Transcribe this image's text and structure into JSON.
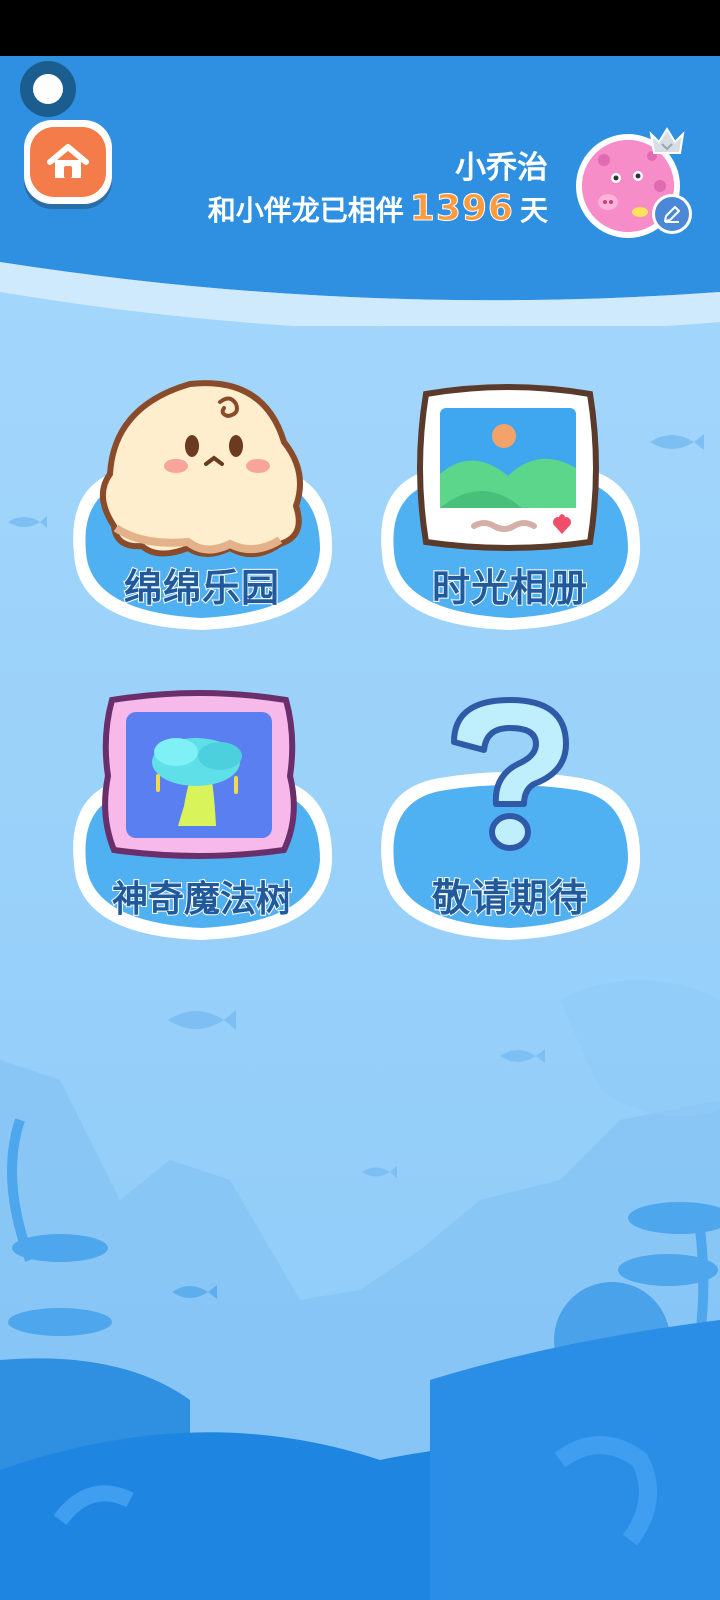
{
  "header": {
    "user_name": "小乔治",
    "companion_prefix": "和小伴龙已相伴",
    "days": "1396",
    "companion_suffix": "天"
  },
  "icons": {
    "home": "home-icon",
    "edit": "pencil-icon",
    "avatar": "pink-pig-avatar",
    "crown": "crown-icon"
  },
  "menu": [
    {
      "label": "绵绵乐园",
      "icon": "fluffy-creature-icon"
    },
    {
      "label": "时光相册",
      "icon": "photo-album-icon"
    },
    {
      "label": "神奇魔法树",
      "icon": "magic-tree-icon"
    },
    {
      "label": "敬请期待",
      "icon": "question-mark-icon"
    }
  ],
  "colors": {
    "header_blue": "#2f8fe0",
    "background": "#9fd4fb",
    "accent_orange": "#f47b4a",
    "label_blue": "#205a9c"
  }
}
